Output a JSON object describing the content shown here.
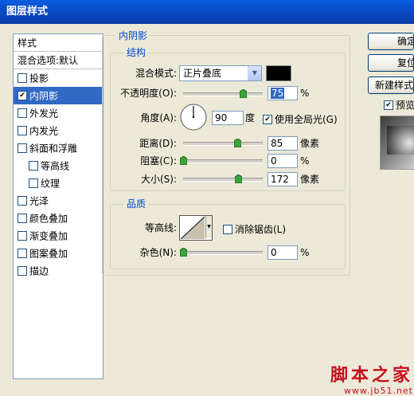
{
  "window": {
    "title": "图层样式"
  },
  "style_list": {
    "header": "样式",
    "blend_options": "混合选项:默认",
    "items": [
      {
        "label": "投影",
        "checked": false,
        "selected": false,
        "indent": false
      },
      {
        "label": "内阴影",
        "checked": true,
        "selected": true,
        "indent": false
      },
      {
        "label": "外发光",
        "checked": false,
        "selected": false,
        "indent": false
      },
      {
        "label": "内发光",
        "checked": false,
        "selected": false,
        "indent": false
      },
      {
        "label": "斜面和浮雕",
        "checked": false,
        "selected": false,
        "indent": false
      },
      {
        "label": "等高线",
        "checked": false,
        "selected": false,
        "indent": true
      },
      {
        "label": "纹理",
        "checked": false,
        "selected": false,
        "indent": true
      },
      {
        "label": "光泽",
        "checked": false,
        "selected": false,
        "indent": false
      },
      {
        "label": "颜色叠加",
        "checked": false,
        "selected": false,
        "indent": false
      },
      {
        "label": "渐变叠加",
        "checked": false,
        "selected": false,
        "indent": false
      },
      {
        "label": "图案叠加",
        "checked": false,
        "selected": false,
        "indent": false
      },
      {
        "label": "描边",
        "checked": false,
        "selected": false,
        "indent": false
      }
    ]
  },
  "inner_shadow": {
    "title": "内阴影",
    "structure": {
      "title": "结构",
      "blend_mode_label": "混合模式:",
      "blend_mode_value": "正片叠底",
      "blend_color": "#000000",
      "opacity_label": "不透明度(O):",
      "opacity_value": "75",
      "opacity_unit": "%",
      "opacity_level": 0.75,
      "angle_label": "角度(A):",
      "angle_value": "90",
      "angle_unit": "度",
      "global_light_label": "使用全局光(G)",
      "global_light_checked": true,
      "distance_label": "距离(D):",
      "distance_value": "85",
      "distance_unit": "像素",
      "distance_level": 0.68,
      "choke_label": "阻塞(C):",
      "choke_value": "0",
      "choke_unit": "%",
      "choke_level": 0,
      "size_label": "大小(S):",
      "size_value": "172",
      "size_unit": "像素",
      "size_level": 0.69
    },
    "quality": {
      "title": "品质",
      "contour_label": "等高线:",
      "antialias_label": "消除锯齿(L)",
      "antialias_checked": false,
      "noise_label": "杂色(N):",
      "noise_value": "0",
      "noise_unit": "%",
      "noise_level": 0
    }
  },
  "buttons": {
    "ok": "确定",
    "reset": "复位",
    "new_style": "新建样式...",
    "preview_label": "预览",
    "preview_checked": true
  },
  "watermark": {
    "main": "脚本之家",
    "url": "www.jb51.net"
  },
  "colors": {
    "selection": "#316ac5",
    "title_accent": "#0046d5",
    "dialog_bg": "#ece9d8"
  }
}
